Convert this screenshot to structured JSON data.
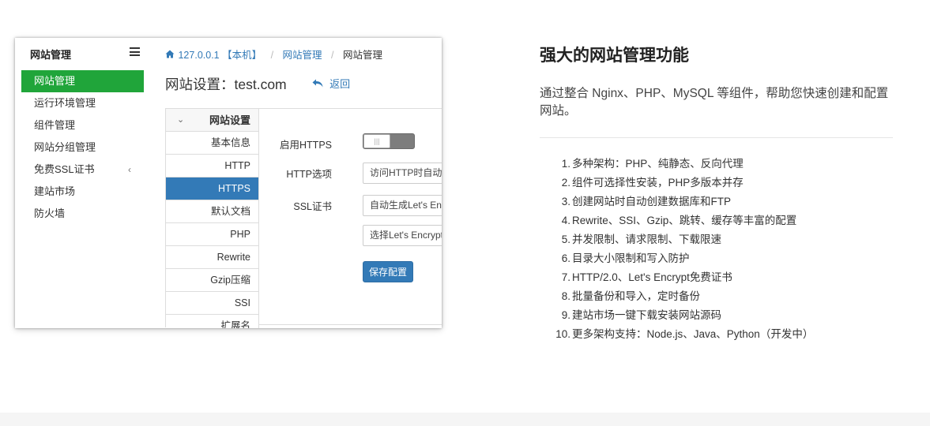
{
  "sidebar": {
    "title": "网站管理",
    "items": [
      {
        "label": "网站管理"
      },
      {
        "label": "运行环境管理"
      },
      {
        "label": "组件管理"
      },
      {
        "label": "网站分组管理"
      },
      {
        "label": "免费SSL证书"
      },
      {
        "label": "建站市场"
      },
      {
        "label": "防火墙"
      }
    ],
    "active_index": 0,
    "ssl_chevron": "‹"
  },
  "breadcrumb": {
    "home_icon": "home-icon",
    "host": "127.0.0.1 【本机】",
    "sep": "/",
    "section": "网站管理",
    "current": "网站管理"
  },
  "page": {
    "title": "网站设置：test.com",
    "back_label": "返回",
    "back_icon": "reply-arrow-icon"
  },
  "tabs": {
    "header": "网站设置",
    "header_caret": "⌄",
    "items": [
      {
        "label": "基本信息"
      },
      {
        "label": "HTTP"
      },
      {
        "label": "HTTPS"
      },
      {
        "label": "默认文档"
      },
      {
        "label": "PHP"
      },
      {
        "label": "Rewrite"
      },
      {
        "label": "Gzip压缩"
      },
      {
        "label": "SSI"
      },
      {
        "label": "扩展名"
      }
    ],
    "active_index": 2
  },
  "form": {
    "https_label": "启用HTTPS",
    "https_enabled": false,
    "https_option_label": "HTTP选项",
    "https_option_value": "访问HTTP时自动跳转",
    "ssl_label": "SSL证书",
    "ssl_value_1": "自动生成Let's Encrypt",
    "ssl_value_2": "选择Let's Encrypt",
    "save_label": "保存配置"
  },
  "features": {
    "title": "强大的网站管理功能",
    "description": "通过整合 Nginx、PHP、MySQL 等组件，帮助您快速创建和配置网站。",
    "items": [
      {
        "num": "1.",
        "text": "多种架构：PHP、纯静态、反向代理"
      },
      {
        "num": "2.",
        "text": "组件可选择性安装，PHP多版本并存"
      },
      {
        "num": "3.",
        "text": "创建网站时自动创建数据库和FTP"
      },
      {
        "num": "4.",
        "text": "Rewrite、SSI、Gzip、跳转、缓存等丰富的配置"
      },
      {
        "num": "5.",
        "text": "并发限制、请求限制、下载限速"
      },
      {
        "num": "6.",
        "text": "目录大小限制和写入防护"
      },
      {
        "num": "7.",
        "text": "HTTP/2.0、Let's Encrypt免费证书"
      },
      {
        "num": "8.",
        "text": "批量备份和导入，定时备份"
      },
      {
        "num": "9.",
        "text": "建站市场一键下载安装网站源码"
      },
      {
        "num": "10.",
        "text": "更多架构支持：Node.js、Java、Python（开发中）"
      }
    ]
  },
  "colors": {
    "sidebar_active": "#20a53a",
    "tab_active": "#337ab7",
    "link": "#337ab7"
  }
}
